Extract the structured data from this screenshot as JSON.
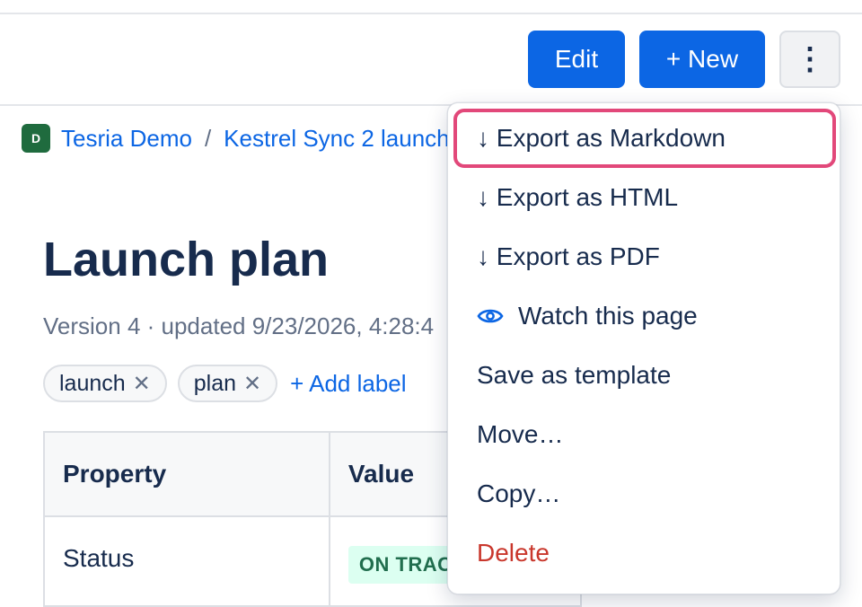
{
  "toolbar": {
    "edit_label": "Edit",
    "new_label": "+ New",
    "more_label": "⋮"
  },
  "breadcrumb": {
    "space_initial": "D",
    "space_name": "Tesria Demo",
    "separator": "/",
    "page_name": "Kestrel Sync 2 launch"
  },
  "page": {
    "title": "Launch plan",
    "meta": "Version 4 · updated 9/23/2026, 4:28:4"
  },
  "labels": {
    "items": [
      "launch",
      "plan"
    ],
    "remove_glyph": "✕",
    "add_label": "+ Add label"
  },
  "properties": {
    "headers": [
      "Property",
      "Value"
    ],
    "rows": [
      {
        "property": "Status",
        "value": "ON TRACK"
      }
    ]
  },
  "menu": {
    "items": [
      {
        "label": "↓ Export as Markdown"
      },
      {
        "label": "↓ Export as HTML"
      },
      {
        "label": "↓ Export as PDF"
      },
      {
        "label": "Watch this page",
        "icon": "eye-icon"
      },
      {
        "label": "Save as template"
      },
      {
        "label": "Move…"
      },
      {
        "label": "Copy…"
      },
      {
        "label": "Delete"
      }
    ],
    "accent_color": "#e2487a",
    "danger_color": "#c9372c"
  },
  "colors": {
    "primary": "#0c66e4",
    "text": "#172b4d",
    "status_bg": "#dcfff1",
    "status_text": "#216e4e"
  }
}
